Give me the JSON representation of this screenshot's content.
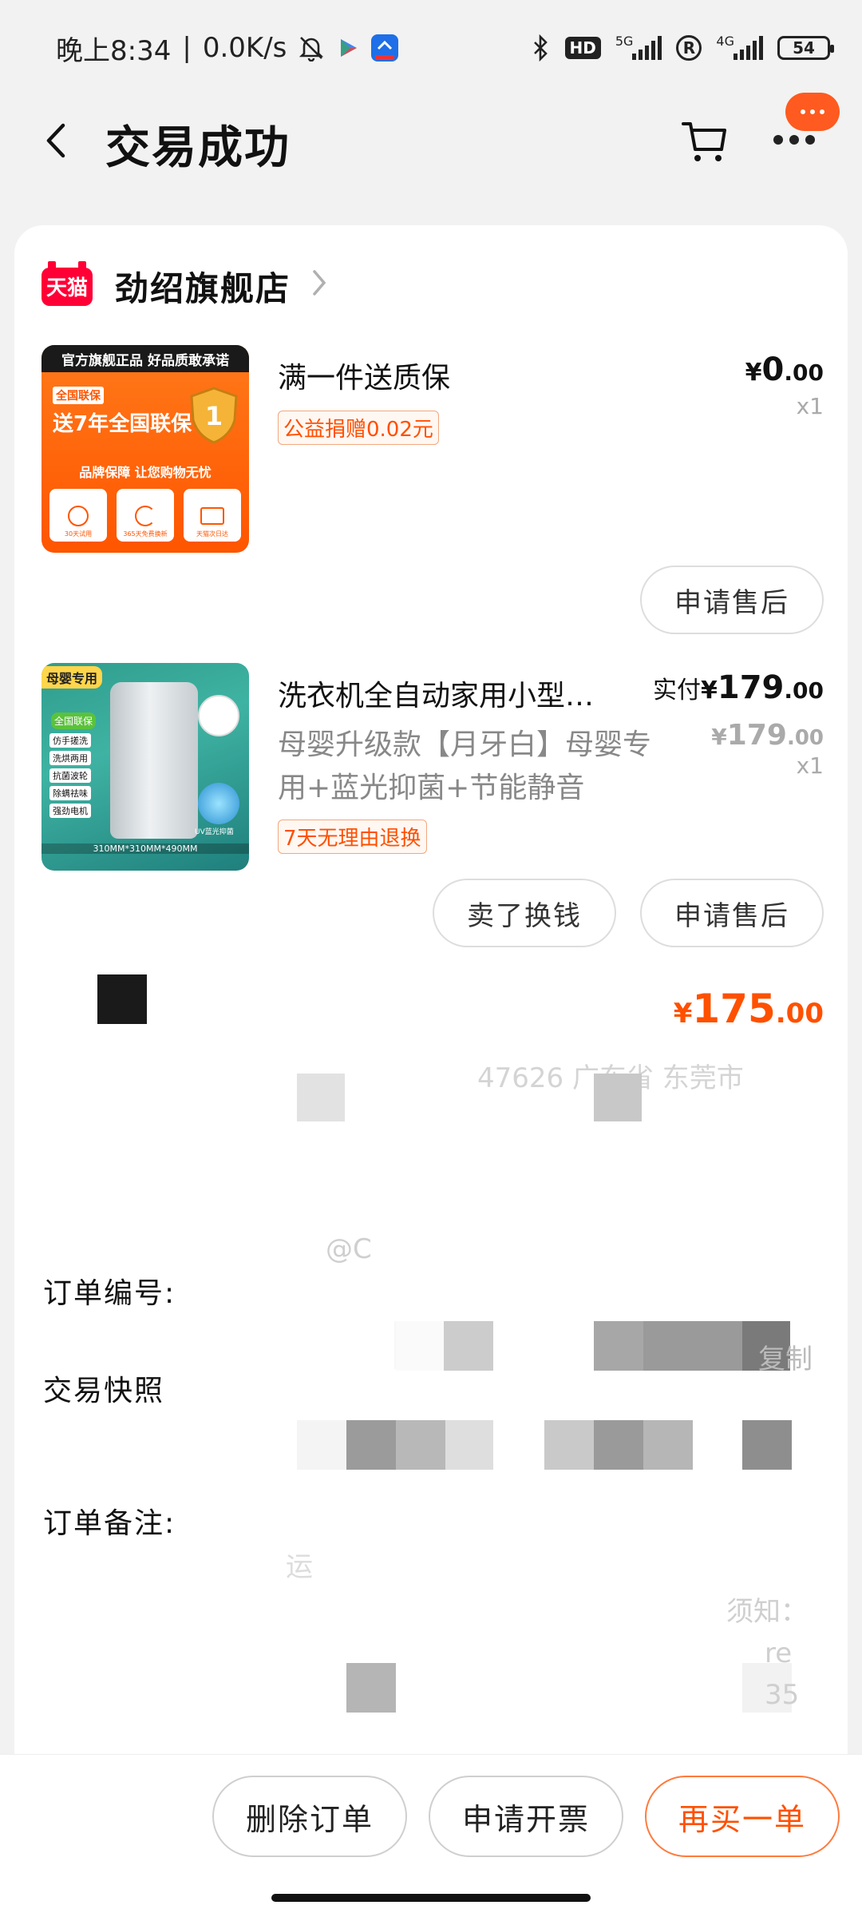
{
  "status_bar": {
    "time": "晚上8:34",
    "speed": "0.0K/s",
    "hd": "HD",
    "net1": "5G",
    "net2": "4G",
    "r_symbol": "R",
    "battery": "54"
  },
  "header": {
    "title": "交易成功"
  },
  "shop": {
    "badge": "天猫",
    "name": "劲绍旗舰店"
  },
  "products": [
    {
      "title": "满一件送质保",
      "tag": "公益捐赠0.02元",
      "price_int": "0",
      "price_dec": ".00",
      "qty": "x1",
      "thumb_texts": {
        "top": "官方旗舰正品 好品质敢承诺",
        "tag": "全国联保",
        "big": "送7年全国联保",
        "line": "品牌保障 让您购物无忧",
        "icons": [
          "30天试用",
          "365天免费换新",
          "天猫次日达"
        ]
      },
      "action": "申请售后"
    },
    {
      "title": "洗衣机全自动家用小型…",
      "subtitle": "母婴升级款【月牙白】母婴专用+蓝光抑菌+节能静音",
      "tag": "7天无理由退换",
      "price_label": "实付",
      "price_int": "179",
      "price_dec": ".00",
      "orig_int": "179",
      "orig_dec": ".00",
      "qty": "x1",
      "thumb_texts": {
        "tag": "母婴专用",
        "badge": "全国联保",
        "features": [
          "仿手搓洗",
          "洗烘两用",
          "抗菌波轮",
          "除螨祛味",
          "强劲电机"
        ],
        "size": "310MM*310MM*490MM",
        "uv": "UV蓝光抑菌"
      },
      "actions": [
        "卖了换钱",
        "申请售后"
      ]
    }
  ],
  "total": {
    "yen": "¥",
    "int": "175",
    "dec": ".00"
  },
  "faint_texts": {
    "address": "47626  广东省 东莞市",
    "at": "@C",
    "copy": "复制",
    "notice": "须知：",
    "re": "re",
    "num": "35",
    "yun": "运"
  },
  "info": {
    "order_no_label": "订单编号:",
    "snapshot_label": "交易快照",
    "remark_label": "订单备注:"
  },
  "bottom_bar": {
    "delete": "删除订单",
    "invoice": "申请开票",
    "rebuy": "再买一单"
  },
  "colors": {
    "accent": "#ff5000",
    "tmall": "#ff0036"
  }
}
